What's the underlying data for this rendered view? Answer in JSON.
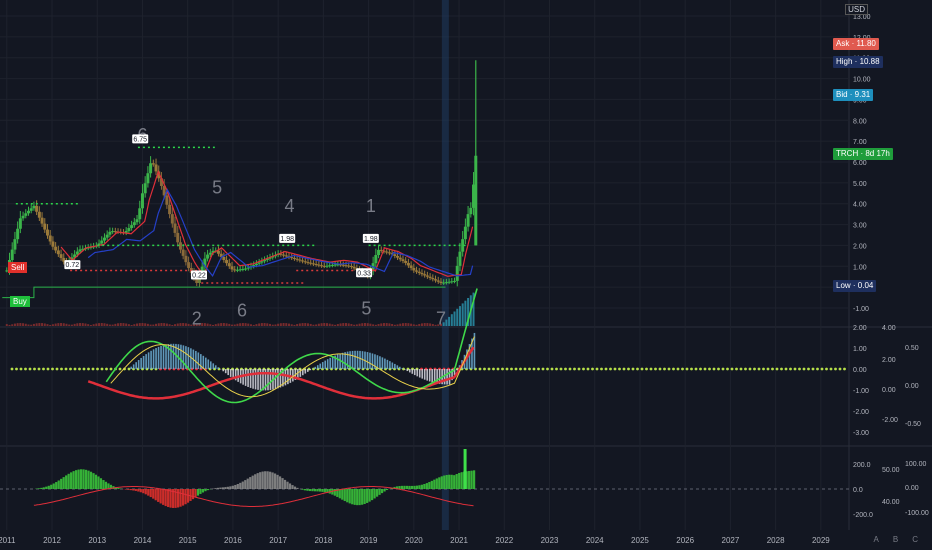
{
  "currency": "USD",
  "price_badges": [
    {
      "id": "ask",
      "label": "Ask",
      "value": "11.80",
      "color": "#e05a4f"
    },
    {
      "id": "high",
      "label": "High",
      "value": "10.88",
      "color": "#1e2f5e"
    },
    {
      "id": "bid",
      "label": "Bid",
      "value": "9.31",
      "color": "#1e8fbd"
    },
    {
      "id": "symbol",
      "label": "TRCH",
      "value": "8d 17h",
      "color": "#1f9d3b"
    },
    {
      "id": "low",
      "label": "Low",
      "value": "0.04",
      "color": "#1e2f5e"
    }
  ],
  "signals": {
    "sell": "Sell",
    "buy": "Buy"
  },
  "bottom_icons": [
    "A",
    "B",
    "C"
  ],
  "chart_data": [
    {
      "type": "line",
      "pane": "price",
      "ylim": [
        -1.0,
        13.0
      ],
      "price_axis_ticks": [
        "13.00",
        "12.00",
        "11.00",
        "10.00",
        "9.00",
        "8.00",
        "7.00",
        "6.00",
        "5.00",
        "4.00",
        "3.00",
        "2.00",
        "1.00",
        "0.00",
        "-1.00"
      ],
      "x_labels": [
        "2011",
        "2012",
        "2013",
        "2014",
        "2015",
        "2016",
        "2017",
        "2018",
        "2019",
        "2020",
        "2021",
        "2022",
        "2023",
        "2024",
        "2025",
        "2026",
        "2027",
        "2028",
        "2029"
      ],
      "x_start": 2010.85,
      "x_end": 2029.6,
      "series": [
        {
          "values_x": [
            2011.0,
            2011.3,
            2011.6,
            2012.0,
            2012.3,
            2012.6,
            2013.0,
            2013.3,
            2013.6,
            2013.9,
            2014.0,
            2014.2,
            2014.4,
            2014.6,
            2014.8,
            2015.0,
            2015.2,
            2015.4,
            2015.6,
            2015.8,
            2016.0,
            2016.3,
            2016.6,
            2017.0,
            2017.3,
            2017.6,
            2018.0,
            2018.3,
            2018.6,
            2019.0,
            2019.2,
            2019.5,
            2019.8,
            2020.0,
            2020.3,
            2020.6,
            2020.9,
            2021.0,
            2021.1,
            2021.2,
            2021.3,
            2021.35,
            2021.4
          ],
          "values": [
            0.8,
            3.3,
            3.9,
            2.0,
            1.1,
            1.8,
            2.0,
            2.7,
            2.6,
            3.3,
            4.5,
            6.1,
            5.0,
            3.5,
            2.0,
            1.0,
            0.2,
            1.5,
            1.8,
            1.3,
            0.8,
            0.9,
            1.2,
            1.6,
            1.4,
            1.2,
            1.0,
            1.1,
            1.0,
            0.5,
            1.8,
            1.6,
            1.2,
            0.8,
            0.5,
            0.2,
            0.3,
            1.5,
            2.5,
            3.5,
            4.0,
            6.3,
            10.88
          ]
        }
      ],
      "annotations": [
        {
          "text": "6",
          "x": 2014.0,
          "y": 7.0
        },
        {
          "text": "5",
          "x": 2015.65,
          "y": 4.5
        },
        {
          "text": "4",
          "x": 2017.25,
          "y": 3.6
        },
        {
          "text": "1",
          "x": 2019.05,
          "y": 3.6
        },
        {
          "text": "2",
          "x": 2015.2,
          "y": -1.8
        },
        {
          "text": "6",
          "x": 2016.2,
          "y": -1.4
        },
        {
          "text": "5",
          "x": 2018.95,
          "y": -1.3
        },
        {
          "text": "7",
          "x": 2020.6,
          "y": -1.8
        }
      ],
      "price_flags": [
        {
          "text": "6.75",
          "x": 2013.95,
          "y": 6.75
        },
        {
          "text": "0.72",
          "x": 2012.45,
          "y": 0.72
        },
        {
          "text": "0.22",
          "x": 2015.25,
          "y": 0.22
        },
        {
          "text": "1.98",
          "x": 2017.2,
          "y": 1.98
        },
        {
          "text": "1.98",
          "x": 2019.05,
          "y": 1.98
        },
        {
          "text": "0.33",
          "x": 2018.9,
          "y": 0.33
        }
      ]
    },
    {
      "type": "line",
      "pane": "macd",
      "left_ticks": [
        "2.00",
        "1.00",
        "0.00",
        "-1.00",
        "-2.00",
        "-3.00"
      ],
      "right_ticks": [
        "4.00",
        "2.00",
        "0.00",
        "-2.00"
      ],
      "far_right_ticks": [
        "0.50",
        "0.00",
        "-0.50"
      ]
    },
    {
      "type": "bar",
      "pane": "oscillator",
      "left_ticks": [
        "200.0",
        "0.0",
        "-200.0"
      ],
      "right_ticks": [
        "50.00",
        "40.00"
      ],
      "far_right_ticks": [
        "100.00",
        "0.00",
        "-100.00"
      ]
    }
  ]
}
